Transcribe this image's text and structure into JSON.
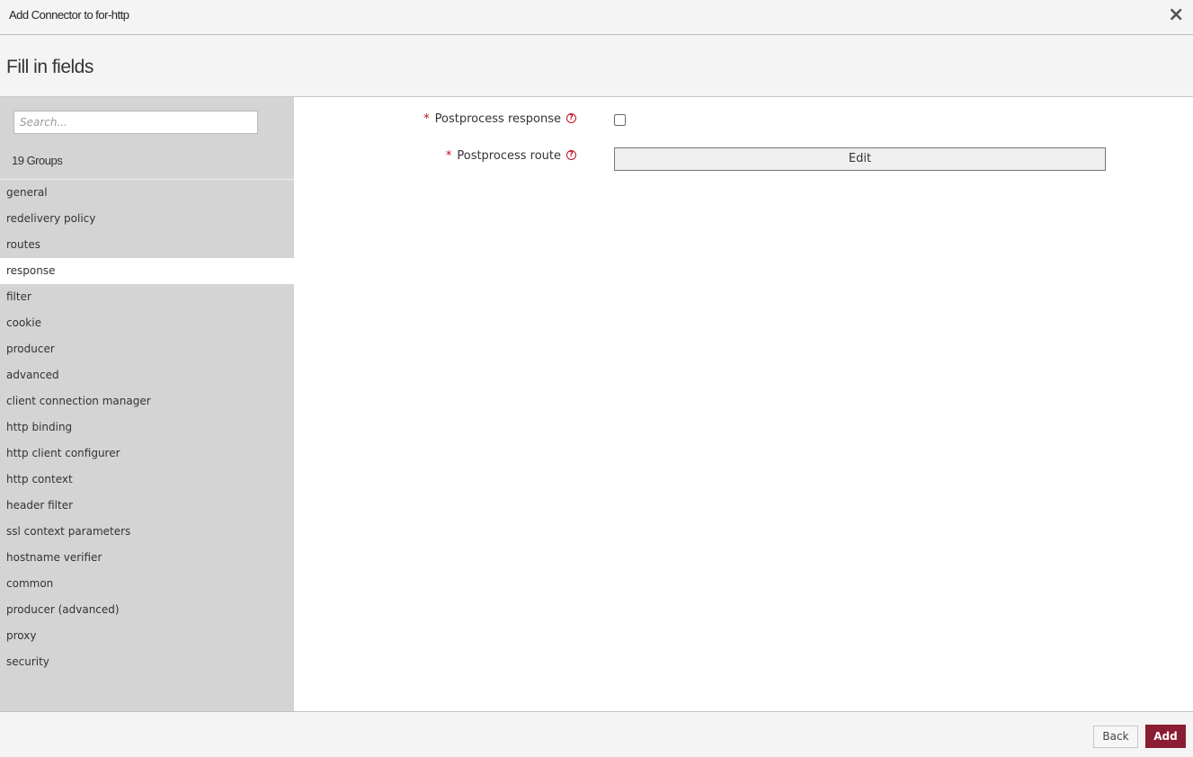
{
  "window": {
    "title": "Add Connector to for-http",
    "close_icon": "×"
  },
  "heading": "Fill in fields",
  "sidebar": {
    "search_placeholder": "Search...",
    "search_value": "",
    "groups_count": "19 Groups",
    "active_group": "response",
    "groups": [
      {
        "label": "general"
      },
      {
        "label": "redelivery policy"
      },
      {
        "label": "routes"
      },
      {
        "label": "response"
      },
      {
        "label": "filter"
      },
      {
        "label": "cookie"
      },
      {
        "label": "producer"
      },
      {
        "label": "advanced"
      },
      {
        "label": "client connection manager"
      },
      {
        "label": "http binding"
      },
      {
        "label": "http client configurer"
      },
      {
        "label": "http context"
      },
      {
        "label": "header filter"
      },
      {
        "label": "ssl context parameters"
      },
      {
        "label": "hostname verifier"
      },
      {
        "label": "common"
      },
      {
        "label": "producer (advanced)"
      },
      {
        "label": "proxy"
      },
      {
        "label": "security"
      }
    ]
  },
  "fields": {
    "required_marker": "*",
    "help_icon": "?",
    "postprocess_response": {
      "label": "Postprocess response",
      "checked": false
    },
    "postprocess_route": {
      "label": "Postprocess route",
      "button_label": "Edit"
    }
  },
  "footer": {
    "back_label": "Back",
    "add_label": "Add"
  },
  "colors": {
    "accent": "#8a1c33",
    "required": "#c0101f"
  }
}
